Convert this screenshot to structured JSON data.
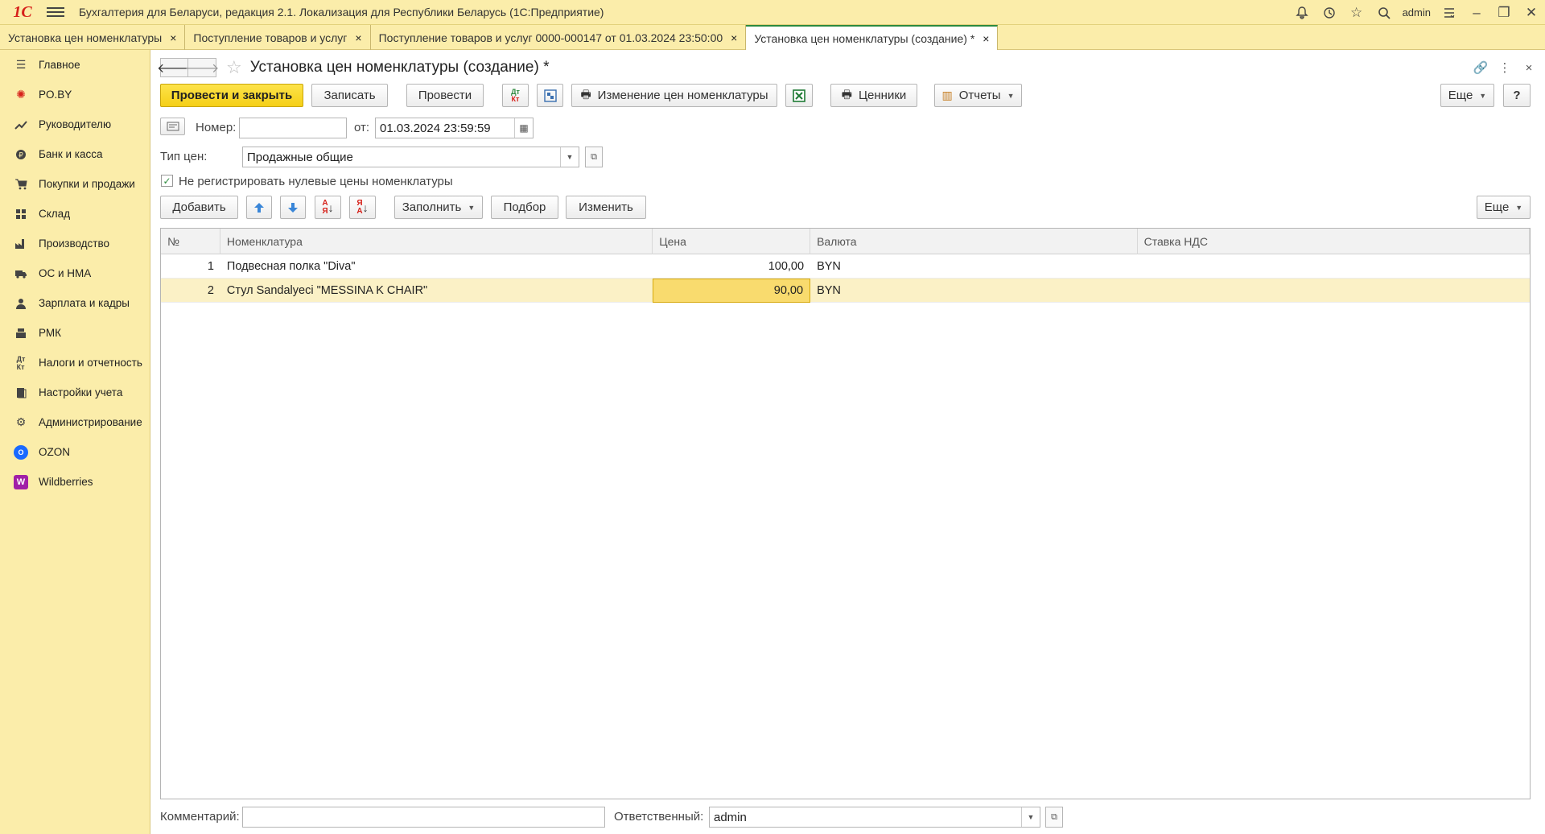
{
  "app": {
    "logo_text": "1С",
    "title": "Бухгалтерия для Беларуси, редакция 2.1. Локализация для Республики Беларусь   (1С:Предприятие)",
    "user": "admin"
  },
  "tabs": [
    {
      "label": "Установка цен номенклатуры",
      "close": "×"
    },
    {
      "label": "Поступление товаров и услуг",
      "close": "×"
    },
    {
      "label": "Поступление товаров и услуг 0000-000147 от 01.03.2024 23:50:00",
      "close": "×"
    },
    {
      "label": "Установка цен номенклатуры (создание) *",
      "close": "×"
    }
  ],
  "sidebar": {
    "items": [
      {
        "label": "Главное",
        "icon": "menu-icon"
      },
      {
        "label": "PO.BY",
        "icon": "poby-icon"
      },
      {
        "label": "Руководителю",
        "icon": "trend-icon"
      },
      {
        "label": "Банк и касса",
        "icon": "coin-icon"
      },
      {
        "label": "Покупки и продажи",
        "icon": "cart-icon"
      },
      {
        "label": "Склад",
        "icon": "warehouse-icon"
      },
      {
        "label": "Производство",
        "icon": "factory-icon"
      },
      {
        "label": "ОС и НМА",
        "icon": "truck-icon"
      },
      {
        "label": "Зарплата и кадры",
        "icon": "person-icon"
      },
      {
        "label": "РМК",
        "icon": "cash-register-icon"
      },
      {
        "label": "Налоги и отчетность",
        "icon": "dt-kt-icon"
      },
      {
        "label": "Настройки учета",
        "icon": "book-icon"
      },
      {
        "label": "Администрирование",
        "icon": "gear-icon"
      },
      {
        "label": "OZON",
        "icon": "ozon-icon"
      },
      {
        "label": "Wildberries",
        "icon": "wildberries-icon"
      }
    ]
  },
  "form": {
    "title": "Установка цен номенклатуры (создание) *",
    "toolbar": {
      "post_close": "Провести и закрыть",
      "save": "Записать",
      "post": "Провести",
      "price_change": "Изменение цен номенклатуры",
      "price_tags": "Ценники",
      "reports": "Отчеты",
      "more": "Еще",
      "help": "?"
    },
    "number_label": "Номер:",
    "number_value": "",
    "date_label": "от:",
    "date_value": "01.03.2024 23:59:59",
    "price_type_label": "Тип цен:",
    "price_type_value": "Продажные общие",
    "checkbox_label": "Не регистрировать нулевые цены номенклатуры",
    "checkbox_checked": true,
    "table_toolbar": {
      "add": "Добавить",
      "fill": "Заполнить",
      "pick": "Подбор",
      "change": "Изменить",
      "more": "Еще"
    },
    "table": {
      "columns": [
        "№",
        "Номенклатура",
        "Цена",
        "Валюта",
        "Ставка НДС"
      ],
      "rows": [
        {
          "n": "1",
          "item": "Подвесная полка \"Diva\"",
          "price": "100,00",
          "currency": "BYN",
          "vat": ""
        },
        {
          "n": "2",
          "item": "Стул Sandalyeci \"MESSINA K CHAIR\"",
          "price": "90,00",
          "currency": "BYN",
          "vat": ""
        }
      ]
    },
    "comment_label": "Комментарий:",
    "comment_value": "",
    "responsible_label": "Ответственный:",
    "responsible_value": "admin"
  },
  "colors": {
    "chrome": "#fbedaa",
    "primary_button": "#f5cf17",
    "active_tab_accent": "#2d8a3e",
    "selected_row": "#fbf1c6"
  }
}
